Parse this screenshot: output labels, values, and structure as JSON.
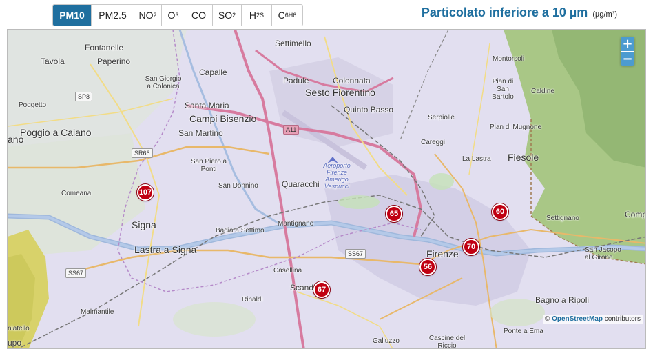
{
  "tabs": [
    {
      "main": "PM10",
      "sub": "",
      "active": true
    },
    {
      "main": "PM2.5",
      "sub": "",
      "active": false
    },
    {
      "main": "NO",
      "sub": "2",
      "active": false
    },
    {
      "main": "O",
      "sub": "3",
      "active": false
    },
    {
      "main": "CO",
      "sub": "",
      "active": false
    },
    {
      "main": "SO",
      "sub": "2",
      "active": false
    },
    {
      "main": "H",
      "sub": "2S",
      "active": false
    },
    {
      "main": "C",
      "sub": "6H6",
      "active": false
    }
  ],
  "heading": {
    "title": "Particolato inferiore a 10 µm",
    "unit": "(µg/m³)"
  },
  "map": {
    "zoom_in": "+",
    "zoom_out": "−",
    "attribution_prefix": "©",
    "attribution_link": "OpenStreetMap",
    "attribution_suffix": "contributors",
    "places": [
      "Fontanelle",
      "Tavola",
      "Paperino",
      "Settimello",
      "Capalle",
      "San Giorgio a Colonica",
      "SP8",
      "Poggetto",
      "Santa Maria",
      "Campi Bisenzio",
      "San Martino",
      "Padule",
      "Colonnata",
      "Sesto Fiorentino",
      "Quinto Basso",
      "Poggio a Caiano",
      "ano",
      "A11",
      "Montorsoli",
      "Pian di San Bartolo",
      "Caldine",
      "Serpiolle",
      "Pian di Mugnone",
      "Careggi",
      "SR66",
      "San Piero a Ponti",
      "La Lastra",
      "Fiesole",
      "Comeana",
      "San Donnino",
      "Quaracchi",
      "Aeroporto Firenze Amerigo Vespucci",
      "Signa",
      "Badia a Settimo",
      "Mantignano",
      "Settignano",
      "Comp",
      "Lastra a Signa",
      "SS67",
      "Firenze",
      "San Jacopo al Girone",
      "SS67",
      "Casellina",
      "Scandicci",
      "Rinaldi",
      "Malmantile",
      "Bagno a Ripoli",
      "niatello",
      "upo",
      "Galluzzo",
      "Cascine del Riccio",
      "Ponte a Ema"
    ],
    "stations": [
      "107",
      "65",
      "60",
      "70",
      "56",
      "67"
    ]
  }
}
